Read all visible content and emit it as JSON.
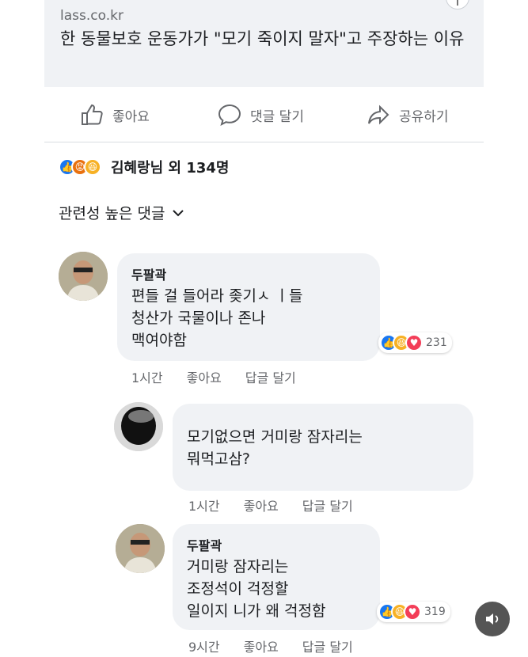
{
  "link_card": {
    "domain": "lass.co.kr",
    "title": "한 동물보호 운동가가 \"모기 죽이지 말자\"고 주장하는 이유"
  },
  "actions": {
    "like": "좋아요",
    "comment": "댓글 달기",
    "share": "공유하기"
  },
  "reactions": {
    "summary": "김혜랑님 외 134명"
  },
  "sort": {
    "label": "관련성 높은 댓글"
  },
  "comments": [
    {
      "author": "두팔곽",
      "lines": [
        "편들 걸 들어라 좆기ㅅ      ㅣ들",
        "청산가      국물이나 존나",
        "맥여야함"
      ],
      "reaction_count": "231",
      "meta": {
        "time": "1시간",
        "like": "좋아요",
        "reply": "답글 달기"
      }
    },
    {
      "author": "",
      "lines": [
        "모기없으면 거미랑 잠자리는",
        "뭐먹고삼?"
      ],
      "reaction_count": "",
      "meta": {
        "time": "1시간",
        "like": "좋아요",
        "reply": "답글 달기"
      }
    },
    {
      "author": "두팔곽",
      "lines": [
        "거미랑 잠자리는",
        "조정석이 걱정할",
        "일이지 니가 왜 걱정함"
      ],
      "reaction_count": "319",
      "meta": {
        "time": "9시간",
        "like": "좋아요",
        "reply": "답글 달기"
      }
    }
  ],
  "colors": {
    "bubble": "#f0f2f5",
    "like_blue": "#1877f2",
    "haha_yellow": "#f7b125",
    "love_red": "#f33e58",
    "meta_gray": "#65676b"
  },
  "icons": [
    "thumbs-up-icon",
    "comment-icon",
    "share-icon",
    "chevron-down-icon",
    "sound-icon"
  ]
}
